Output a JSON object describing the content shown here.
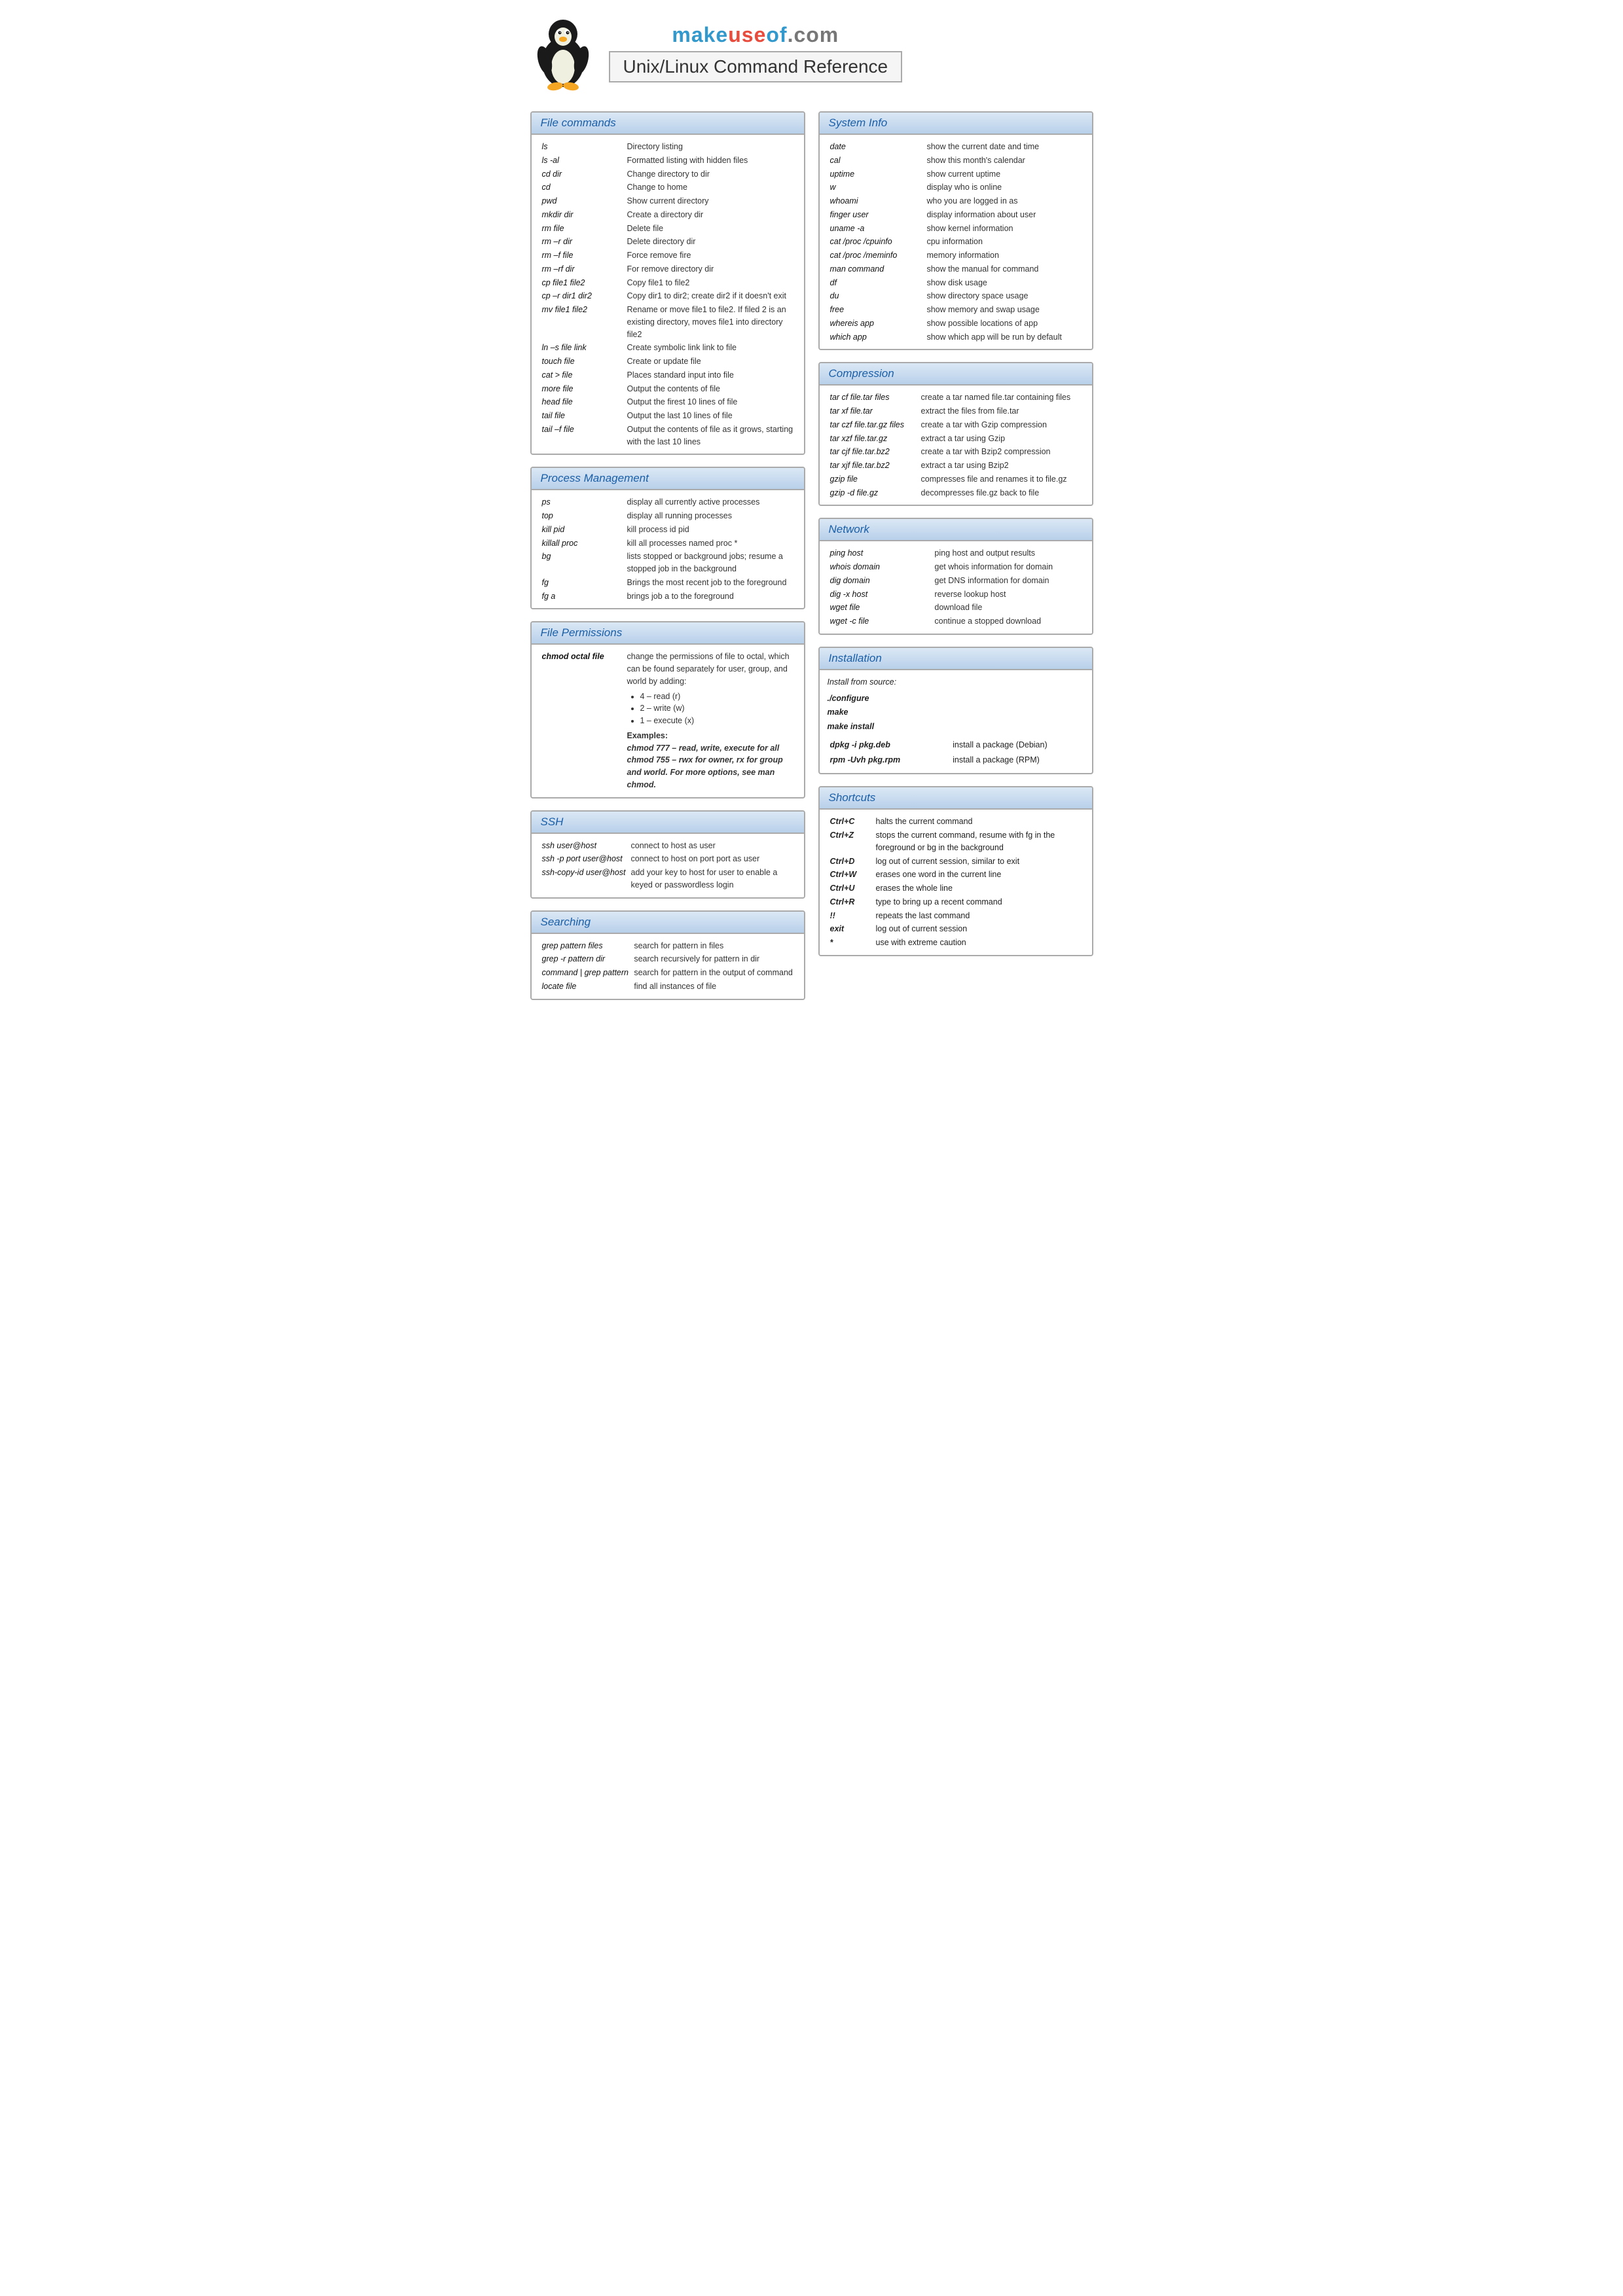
{
  "header": {
    "brand": "makeuseof.com",
    "page_title": "Unix/Linux Command Reference"
  },
  "sections": {
    "file_commands": {
      "title": "File commands",
      "items": [
        [
          "ls",
          "Directory listing"
        ],
        [
          "ls -al",
          "Formatted listing with hidden files"
        ],
        [
          "cd dir",
          "Change directory to dir"
        ],
        [
          "cd",
          "Change to home"
        ],
        [
          "pwd",
          "Show current directory"
        ],
        [
          "mkdir dir",
          "Create a directory dir"
        ],
        [
          "rm file",
          "Delete file"
        ],
        [
          "rm –r dir",
          "Delete directory dir"
        ],
        [
          "rm –f file",
          "Force remove fire"
        ],
        [
          "rm –rf dir",
          "For remove directory dir"
        ],
        [
          "cp file1 file2",
          "Copy file1 to file2"
        ],
        [
          "cp –r dir1 dir2",
          "Copy dir1 to dir2; create dir2 if it doesn't exit"
        ],
        [
          "mv file1 file2",
          "Rename or move file1 to file2. If filed 2 is an existing directory, moves file1 into directory  file2"
        ],
        [
          "ln –s file link",
          "Create symbolic link link to file"
        ],
        [
          "touch file",
          "Create or update file"
        ],
        [
          "cat > file",
          "Places standard input into file"
        ],
        [
          "more file",
          "Output the contents of file"
        ],
        [
          "head file",
          "Output the firest 10 lines of file"
        ],
        [
          "tail file",
          "Output the last 10 lines of file"
        ],
        [
          "tail –f file",
          "Output the contents of file as it grows, starting with the last 10 lines"
        ]
      ]
    },
    "process_management": {
      "title": "Process Management",
      "items": [
        [
          "ps",
          "display all currently active processes"
        ],
        [
          "top",
          "display all running processes"
        ],
        [
          "kill pid",
          "kill process id pid"
        ],
        [
          "killall proc",
          "kill all processes named proc *"
        ],
        [
          "bg",
          "lists stopped or background jobs; resume a stopped job in the background"
        ],
        [
          "fg",
          "Brings the most recent job to the foreground"
        ],
        [
          "fg a",
          "brings job a to the foreground"
        ]
      ]
    },
    "file_permissions": {
      "title": "File Permissions",
      "cmd": "chmod octal file",
      "desc": "change the permissions of file to octal, which can be found separately for user, group, and world by adding:",
      "items": [
        "4 – read (r)",
        "2 – write (w)",
        "1 – execute (x)"
      ],
      "examples_label": "Examples:",
      "example1": "chmod 777 – read, write, execute for all",
      "example2": "chmod 755 – rwx for owner, rx for group and world. For more options, see man chmod."
    },
    "ssh": {
      "title": "SSH",
      "items": [
        [
          "ssh user@host",
          "connect to host as user"
        ],
        [
          "ssh -p port user@host",
          "connect to host on port port as user"
        ],
        [
          "ssh-copy-id user@host",
          "add your key to host for user to enable a keyed or passwordless login"
        ]
      ]
    },
    "searching": {
      "title": "Searching",
      "items": [
        [
          "grep pattern files",
          "search for pattern in files"
        ],
        [
          "grep -r pattern dir",
          "search recursively for pattern in dir"
        ],
        [
          "command | grep pattern",
          "search for pattern in the output of command"
        ],
        [
          "locate file",
          "find all instances of file"
        ]
      ]
    },
    "system_info": {
      "title": "System Info",
      "items": [
        [
          "date",
          "show the current date and time"
        ],
        [
          "cal",
          "show this month's calendar"
        ],
        [
          "uptime",
          "show current uptime"
        ],
        [
          "w",
          "display who is online"
        ],
        [
          "whoami",
          "who you are logged in as"
        ],
        [
          "finger user",
          "display information about user"
        ],
        [
          "uname -a",
          "show kernel information"
        ],
        [
          "cat /proc /cpuinfo",
          "cpu information"
        ],
        [
          "cat /proc /meminfo",
          "memory information"
        ],
        [
          "man command",
          "show the manual for command"
        ],
        [
          "df",
          "show disk usage"
        ],
        [
          "du",
          "show directory space usage"
        ],
        [
          "free",
          "show memory and swap usage"
        ],
        [
          "whereis app",
          "show possible locations of app"
        ],
        [
          "which app",
          "show which app will be run by default"
        ]
      ]
    },
    "compression": {
      "title": "Compression",
      "items": [
        [
          "tar cf file.tar files",
          "create a tar named file.tar containing files"
        ],
        [
          "tar xf file.tar",
          "extract the files from file.tar"
        ],
        [
          "tar czf file.tar.gz files",
          "create a tar with Gzip compression"
        ],
        [
          "tar xzf file.tar.gz",
          "extract a tar using Gzip"
        ],
        [
          "tar cjf file.tar.bz2",
          "create a tar with Bzip2 compression"
        ],
        [
          "tar xjf file.tar.bz2",
          "extract a tar using Bzip2"
        ],
        [
          "gzip file",
          "compresses file and renames it to file.gz"
        ],
        [
          "gzip -d file.gz",
          "decompresses file.gz back to file"
        ]
      ]
    },
    "network": {
      "title": "Network",
      "items": [
        [
          "ping host",
          "ping host and output results"
        ],
        [
          "whois domain",
          "get whois information for domain"
        ],
        [
          "dig domain",
          "get DNS information for domain"
        ],
        [
          "dig -x host",
          "reverse lookup host"
        ],
        [
          "wget file",
          "download file"
        ],
        [
          "wget -c file",
          "continue a stopped download"
        ]
      ]
    },
    "installation": {
      "title": "Installation",
      "from_source": "Install from source:",
      "source_cmds": [
        "./configure",
        "make",
        "make install"
      ],
      "pkg_items": [
        [
          "dpkg -i pkg.deb",
          "install a package (Debian)"
        ],
        [
          "rpm -Uvh pkg.rpm",
          "install a package (RPM)"
        ]
      ]
    },
    "shortcuts": {
      "title": "Shortcuts",
      "items": [
        [
          "Ctrl+C",
          "halts the current command"
        ],
        [
          "Ctrl+Z",
          "stops the current command, resume with fg in the foreground or bg in the background"
        ],
        [
          "Ctrl+D",
          "log out of current session, similar to exit"
        ],
        [
          "Ctrl+W",
          "erases one word in the current line"
        ],
        [
          "Ctrl+U",
          "erases the whole line"
        ],
        [
          "Ctrl+R",
          "type to bring up a recent command"
        ],
        [
          "!!",
          "repeats the last command"
        ],
        [
          "exit",
          "log out of current session"
        ],
        [
          "*",
          "use with extreme caution"
        ]
      ]
    }
  }
}
